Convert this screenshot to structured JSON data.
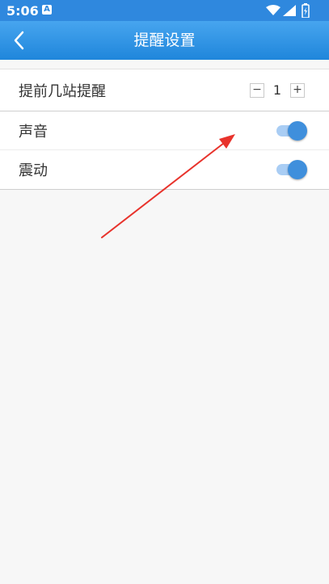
{
  "status_bar": {
    "time": "5:06",
    "notification_icon": "A"
  },
  "header": {
    "title": "提醒设置",
    "back_icon": "chevron-left-icon"
  },
  "settings": {
    "advance_stops": {
      "label": "提前几站提醒",
      "value": "1",
      "minus": "−",
      "plus": "+"
    },
    "sound": {
      "label": "声音",
      "enabled": true
    },
    "vibration": {
      "label": "震动",
      "enabled": true
    }
  },
  "colors": {
    "accent": "#2f88de",
    "toggle_thumb": "#3f8fdc",
    "toggle_track": "#a9cdf4",
    "annotation_arrow": "#e8332c"
  }
}
